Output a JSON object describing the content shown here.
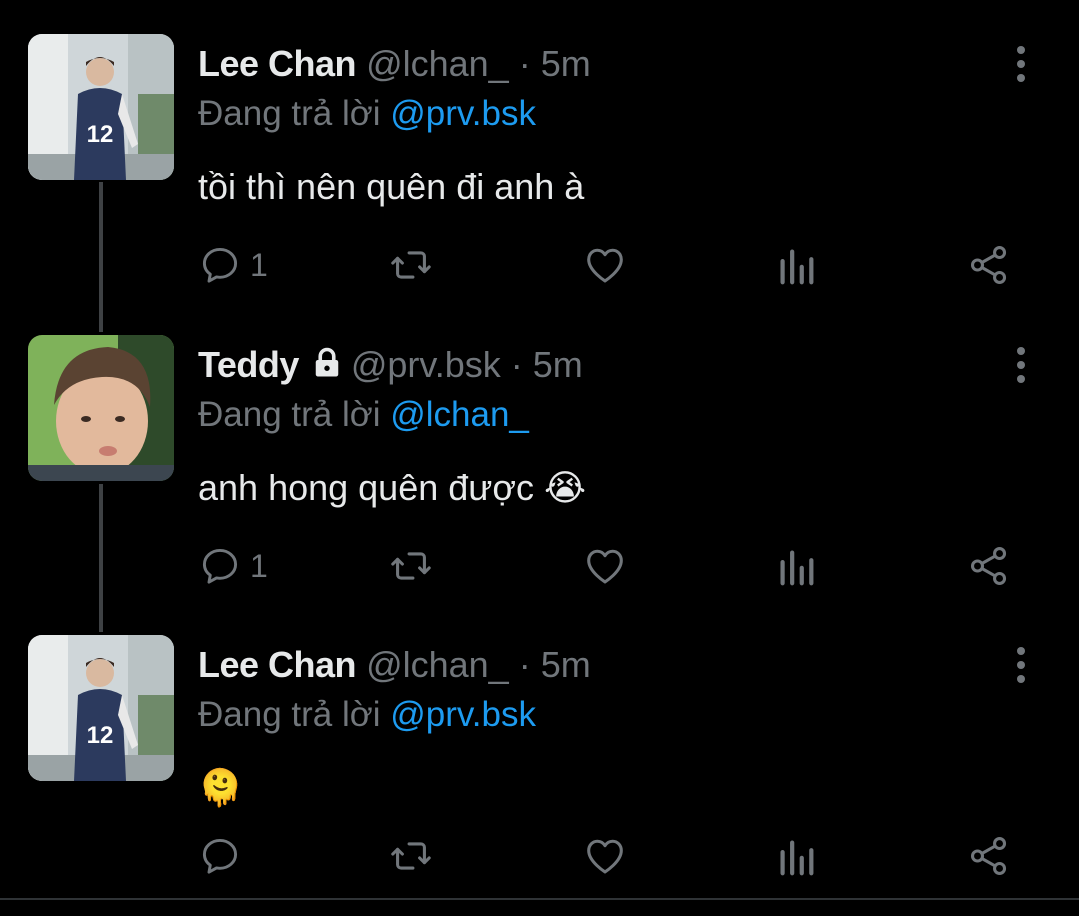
{
  "colors": {
    "background": "#000000",
    "text": "#e7e9ea",
    "secondary": "#71767b",
    "link": "#1d9bf0",
    "thread_line": "#3e4144"
  },
  "tweets": [
    {
      "name": "Lee Chan",
      "handle": "@lchan_",
      "time": "· 5m",
      "reply_prefix": "Đang trả lời",
      "reply_mention": "@prv.bsk",
      "text": "tồi thì nên quên đi anh à",
      "emoji": "",
      "locked": false,
      "reply_count": "1",
      "avatar": "avatar-lee-chan"
    },
    {
      "name": "Teddy",
      "handle": "@prv.bsk",
      "time": "· 5m",
      "reply_prefix": "Đang trả lời",
      "reply_mention": "@lchan_",
      "text": "anh hong quên được",
      "emoji": "😭",
      "locked": true,
      "reply_count": "1",
      "avatar": "avatar-teddy"
    },
    {
      "name": "Lee Chan",
      "handle": "@lchan_",
      "time": "· 5m",
      "reply_prefix": "Đang trả lời",
      "reply_mention": "@prv.bsk",
      "text": "",
      "emoji": "🫠",
      "locked": false,
      "reply_count": "",
      "avatar": "avatar-lee-chan"
    }
  ],
  "icons": {
    "more": "more-vertical-icon",
    "reply": "reply-bubble-icon",
    "retweet": "retweet-icon",
    "like": "heart-icon",
    "views": "views-chart-icon",
    "share": "share-icon",
    "lock": "lock-icon"
  }
}
